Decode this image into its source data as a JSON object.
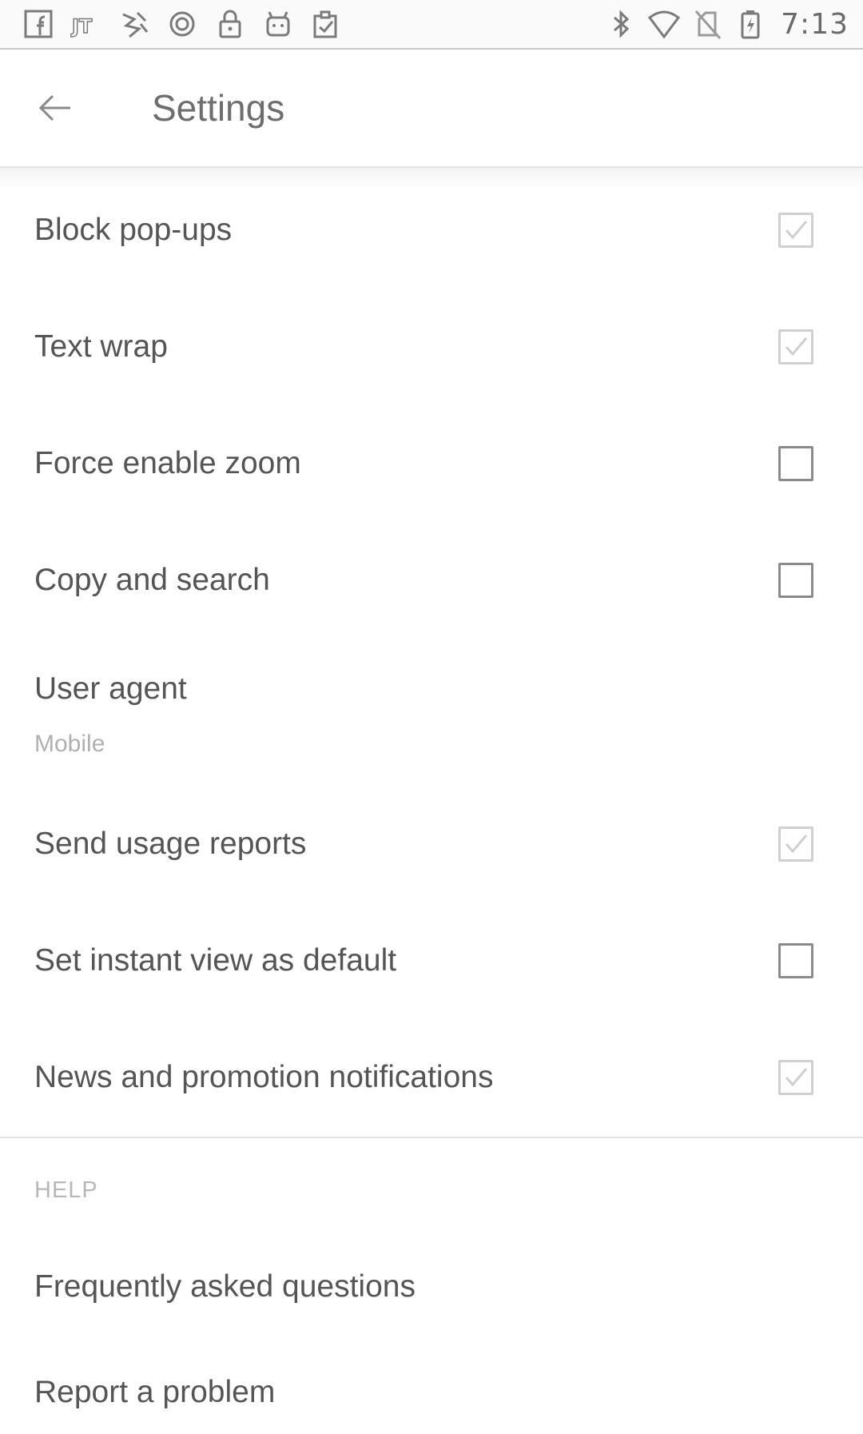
{
  "status_bar": {
    "left_icons": [
      "facebook-icon",
      "jt-app-icon",
      "news-app-icon",
      "circle-app-icon",
      "lock-icon",
      "android-icon",
      "clipboard-check-icon"
    ],
    "right_icons": [
      "bluetooth-icon",
      "wifi-icon",
      "no-sim-icon",
      "battery-charging-icon"
    ],
    "time": "7:13"
  },
  "app_bar": {
    "title": "Settings",
    "back_icon": "arrow-left-icon"
  },
  "settings": [
    {
      "label": "Block pop-ups",
      "checked": true
    },
    {
      "label": "Text wrap",
      "checked": true
    },
    {
      "label": "Force enable zoom",
      "checked": false
    },
    {
      "label": "Copy and search",
      "checked": false
    }
  ],
  "user_agent": {
    "label": "User agent",
    "value": "Mobile"
  },
  "settings2": [
    {
      "label": "Send usage reports",
      "checked": true
    },
    {
      "label": "Set instant view as default",
      "checked": false
    },
    {
      "label": "News and promotion notifications",
      "checked": true
    }
  ],
  "help": {
    "header": "HELP",
    "items": [
      {
        "label": "Frequently asked questions"
      },
      {
        "label": "Report a problem"
      }
    ]
  }
}
